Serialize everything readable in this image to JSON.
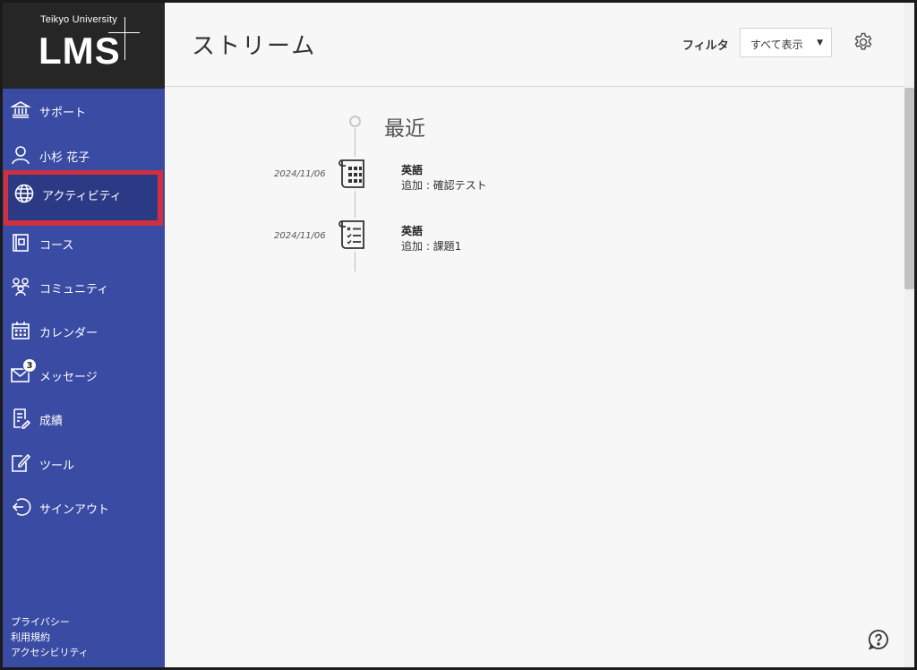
{
  "logo": {
    "university": "Teikyo University",
    "product": "LMS"
  },
  "sidebar": {
    "items": [
      {
        "label": "サポート",
        "icon": "bank-icon"
      },
      {
        "label": "小杉 花子",
        "icon": "user-icon"
      },
      {
        "label": "アクティビティ",
        "icon": "globe-icon",
        "active": true
      },
      {
        "label": "コース",
        "icon": "book-icon"
      },
      {
        "label": "コミュニティ",
        "icon": "community-icon"
      },
      {
        "label": "カレンダー",
        "icon": "calendar-icon"
      },
      {
        "label": "メッセージ",
        "icon": "mail-icon",
        "badge": "3"
      },
      {
        "label": "成績",
        "icon": "grades-icon"
      },
      {
        "label": "ツール",
        "icon": "tools-icon"
      },
      {
        "label": "サインアウト",
        "icon": "signout-icon"
      }
    ],
    "footer": [
      "プライバシー",
      "利用規約",
      "アクセシビリティ"
    ]
  },
  "header": {
    "title": "ストリーム",
    "filter_label": "フィルタ",
    "filter_value": "すべて表示"
  },
  "stream": {
    "section_title": "最近",
    "items": [
      {
        "date": "2024/11/06",
        "course": "英語",
        "description": "追加 : 確認テスト",
        "icon": "test-icon"
      },
      {
        "date": "2024/11/06",
        "course": "英語",
        "description": "追加 : 課題1",
        "icon": "assignment-icon"
      }
    ]
  },
  "colors": {
    "sidebar": "#3a4ba3",
    "logo_bg": "#262626",
    "highlight": "#cf2f3e"
  }
}
